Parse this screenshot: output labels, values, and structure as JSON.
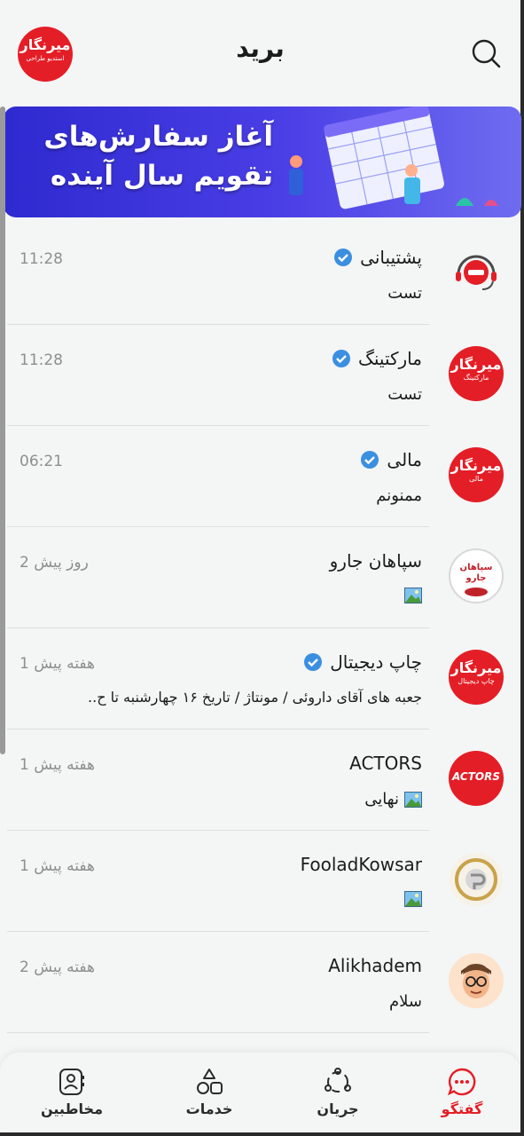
{
  "header": {
    "title": "برید",
    "logo": {
      "line1": "میرنگار",
      "line2": "استدیو طراحی"
    },
    "search_icon": "search-icon"
  },
  "banner": {
    "line1": "آغاز سفارش‌های",
    "line2": "تقویم سال آینده"
  },
  "conversations": [
    {
      "name": "پشتیبانی",
      "verified": true,
      "time": "11:28",
      "preview": "تست",
      "avatar": {
        "type": "support-headset-icon"
      }
    },
    {
      "name": "مارکتینگ",
      "verified": true,
      "time": "11:28",
      "preview": "تست",
      "avatar": {
        "line1": "میرنگار",
        "line2": "مارکتینگ"
      }
    },
    {
      "name": "مالی",
      "verified": true,
      "time": "06:21",
      "preview": "ممنونم",
      "avatar": {
        "line1": "میرنگار",
        "line2": "مالی"
      }
    },
    {
      "name": "سپاهان جارو",
      "verified": false,
      "time": "2 روز پیش",
      "preview": "",
      "has_image": true,
      "avatar": {
        "line1": "سپاهان جارو"
      }
    },
    {
      "name": "چاپ دیجیتال",
      "verified": true,
      "time": "1 هفته پیش",
      "preview": "جعبه های آقای داروئی / مونتاژ / تاریخ ۱۶ چهارشنبه تا ح..",
      "avatar": {
        "line1": "میرنگار",
        "line2": "چاپ دیجیتال"
      }
    },
    {
      "name": "ACTORS",
      "verified": false,
      "time": "1 هفته پیش",
      "preview": "نهایی",
      "has_image": true,
      "avatar": {
        "line1": "ACTORS"
      }
    },
    {
      "name": "FooladKowsar",
      "verified": false,
      "time": "1 هفته پیش",
      "preview": "",
      "has_image": true,
      "avatar": {
        "type": "gold-circle-logo"
      }
    },
    {
      "name": "Alikhadem",
      "verified": false,
      "time": "2 هفته پیش",
      "preview": "سلام",
      "avatar": {
        "type": "memoji-glasses"
      }
    }
  ],
  "nav": [
    {
      "label": "گفتگو",
      "icon": "chat-icon",
      "active": true
    },
    {
      "label": "جریان",
      "icon": "flow-icon",
      "active": false
    },
    {
      "label": "خدمات",
      "icon": "services-shapes-icon",
      "active": false
    },
    {
      "label": "مخاطبین",
      "icon": "contacts-icon",
      "active": false
    }
  ],
  "colors": {
    "accent": "#e41e26",
    "verified": "#3b8fe0",
    "banner": "#3d35dc"
  }
}
